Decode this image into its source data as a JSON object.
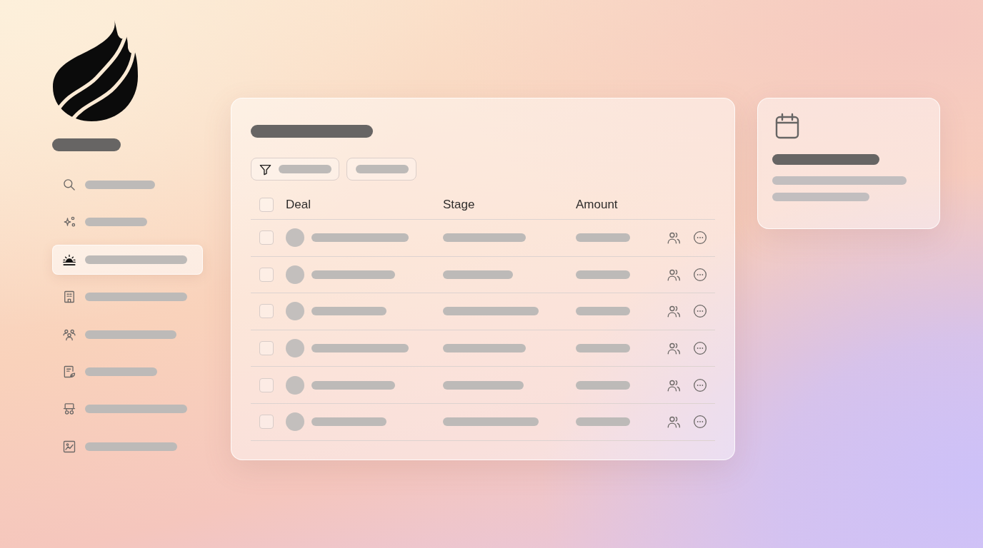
{
  "sidebar": {
    "items": [
      {
        "selected": false
      },
      {
        "selected": false
      },
      {
        "selected": true
      },
      {
        "selected": false
      },
      {
        "selected": false
      },
      {
        "selected": false
      },
      {
        "selected": false
      },
      {
        "selected": false
      }
    ]
  },
  "deals_table": {
    "select_all": {
      "checked": false
    },
    "columns": [
      "Deal",
      "Stage",
      "Amount"
    ],
    "rows": [
      {
        "checked": false
      },
      {
        "checked": false
      },
      {
        "checked": false
      },
      {
        "checked": false
      },
      {
        "checked": false
      },
      {
        "checked": false
      }
    ]
  }
}
